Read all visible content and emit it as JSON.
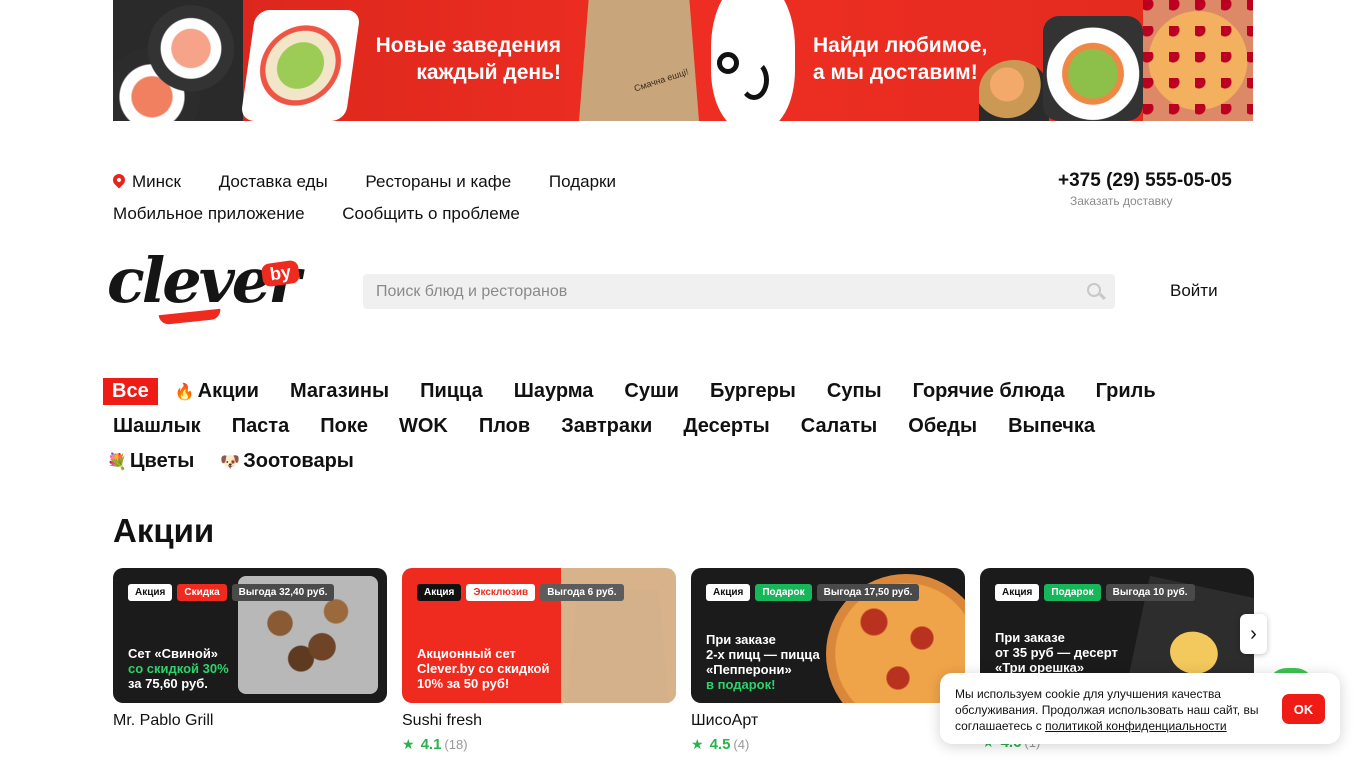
{
  "banner": {
    "text_left": "Новые заведения каждый день!",
    "text_right": "Найди любимое, а мы доставим!",
    "bag_label": "Смачна ешці!"
  },
  "top_nav": {
    "city": "Минск",
    "links_row1": [
      "Доставка еды",
      "Рестораны и кафе",
      "Подарки"
    ],
    "links_row2": [
      "Мобильное приложение",
      "Сообщить о проблеме"
    ],
    "phone": "+375 (29) 555-05-05",
    "phone_sub": "Заказать доставку"
  },
  "logo": {
    "text": "clever",
    "by": "by"
  },
  "search": {
    "placeholder": "Поиск блюд и ресторанов",
    "value": ""
  },
  "login_label": "Войти",
  "categories": {
    "row1": [
      "Все",
      "Акции",
      "Магазины",
      "Пицца",
      "Шаурма",
      "Суши",
      "Бургеры",
      "Супы",
      "Горячие блюда",
      "Гриль"
    ],
    "row2": [
      "Шашлык",
      "Паста",
      "Поке",
      "WOK",
      "Плов",
      "Завтраки",
      "Десерты",
      "Салаты",
      "Обеды",
      "Выпечка"
    ],
    "row3": [
      "Цветы",
      "Зоотовары"
    ],
    "icons": {
      "promo": "fire-icon",
      "flowers": "flower-icon",
      "pets": "dog-icon"
    }
  },
  "section_title": "Акции",
  "cards": [
    {
      "name": "Mr. Pablo Grill",
      "badges": [
        "Акция",
        "Скидка",
        "Выгода 32,40 руб."
      ],
      "promo_line1": "Сет «Свиной»",
      "promo_line2": "со скидкой 30%",
      "promo_line3": "за 75,60 руб."
    },
    {
      "name": "Sushi fresh",
      "rating": "4.1",
      "rating_count": "(18)",
      "badges": [
        "Акция",
        "Эксклюзив",
        "Выгода 6 руб."
      ],
      "promo_line1": "Акционный сет",
      "promo_line2": "Clever.by со скидкой",
      "promo_line3": "10% за 50 руб!"
    },
    {
      "name": "ШисоАрт",
      "rating": "4.5",
      "rating_count": "(4)",
      "badges": [
        "Акция",
        "Подарок",
        "Выгода 17,50 руб."
      ],
      "promo_line1": "При заказе",
      "promo_line2": "2-х пицц — пицца",
      "promo_line3": "«Пепперони»",
      "promo_line4": "в подарок!"
    },
    {
      "rating": "4.6",
      "rating_count": "(1)",
      "badges": [
        "Акция",
        "Подарок",
        "Выгода 10 руб."
      ],
      "promo_line1": "При заказе",
      "promo_line2": "от 35 руб — десерт",
      "promo_line3": "«Три орешка»"
    }
  ],
  "cookie": {
    "text": "Мы используем cookie для улучшения качества обслуживания. Продолжая использовать наш сайт, вы соглашаетесь с",
    "link": "политикой конфиденциальности",
    "ok": "OK"
  },
  "colors": {
    "brand_red": "#ef1b15",
    "rating_green": "#2bb24c",
    "promo_green": "#18b65a"
  }
}
